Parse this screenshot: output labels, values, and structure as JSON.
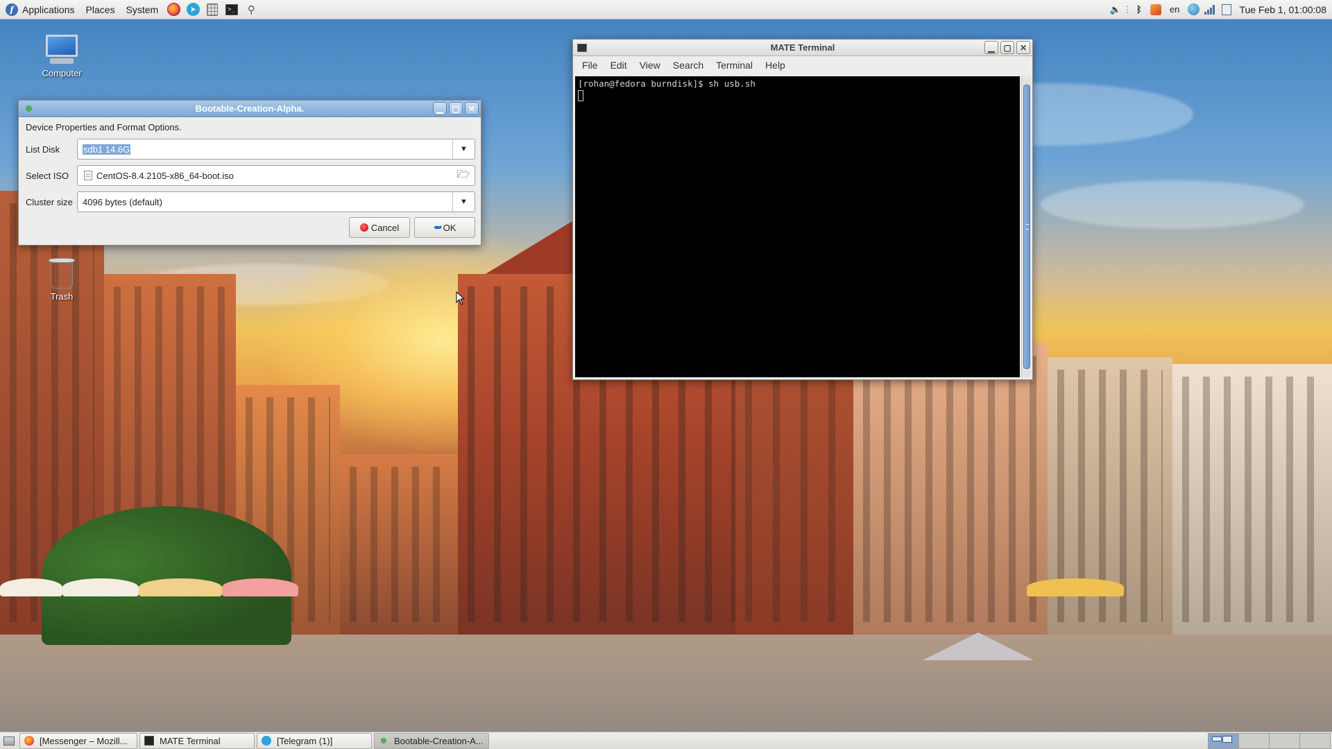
{
  "colors": {
    "accent": "#7fa7d6",
    "terminal_bg": "#000000",
    "terminal_fg": "#d3d7cf",
    "cancel_icon": "#c40000",
    "panel": "#e3e2e0"
  },
  "top_panel": {
    "menus": [
      "Applications",
      "Places",
      "System"
    ],
    "launchers": [
      "firefox-icon",
      "telegram-icon",
      "calculator-icon",
      "terminal-icon",
      "pin-icon"
    ],
    "tray_icons": [
      "volume-icon",
      "bluetooth-icon",
      "shield-icon",
      "network-icon",
      "signal-icon",
      "notes-icon"
    ],
    "keyboard_layout": "en",
    "clock": "Tue Feb 1, 01:00:08"
  },
  "desktop": {
    "icons": [
      {
        "label": "Computer",
        "icon": "computer-icon"
      },
      {
        "label": "Trash",
        "icon": "trash-icon"
      }
    ]
  },
  "boot_dialog": {
    "title": "Bootable-Creation-Alpha.",
    "heading": "Device Properties and Format Options.",
    "list_disk": {
      "label": "List Disk",
      "value": "sdb1 14.6G"
    },
    "select_iso": {
      "label": "Select ISO",
      "value": "CentOS-8.4.2105-x86_64-boot.iso"
    },
    "cluster_size": {
      "label": "Cluster size",
      "value": "4096 bytes (default)"
    },
    "cancel_label": "Cancel",
    "ok_label": "OK"
  },
  "terminal": {
    "title": "MATE Terminal",
    "menu": [
      "File",
      "Edit",
      "View",
      "Search",
      "Terminal",
      "Help"
    ],
    "prompt": "[rohan@fedora burndisk]$ sh usb.sh"
  },
  "taskbar": {
    "tasks": [
      {
        "label": "[Messenger – Mozill...",
        "icon": "firefox-icon"
      },
      {
        "label": "MATE Terminal",
        "icon": "terminal-icon"
      },
      {
        "label": "[Telegram (1)]",
        "icon": "telegram-icon"
      },
      {
        "label": "Bootable-Creation-A...",
        "icon": "app-dot-icon"
      }
    ],
    "workspaces": 4
  }
}
